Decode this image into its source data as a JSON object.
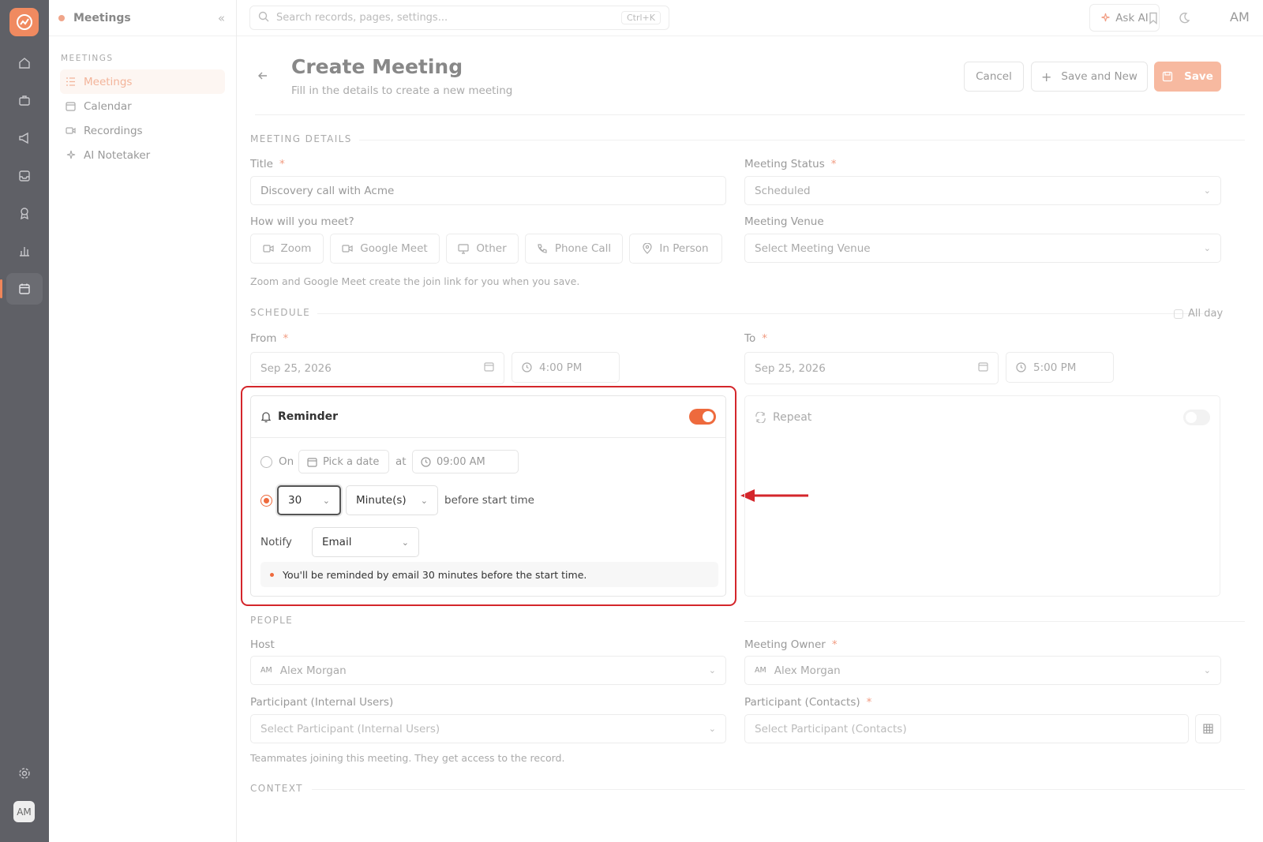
{
  "sidebar": {
    "title": "Meetings",
    "section": "MEETINGS",
    "items": [
      {
        "label": "Meetings",
        "icon": "list-icon"
      },
      {
        "label": "Calendar",
        "icon": "calendar-icon"
      },
      {
        "label": "Recordings",
        "icon": "video-icon"
      },
      {
        "label": "AI Notetaker",
        "icon": "sparkle-icon"
      }
    ]
  },
  "rail": {
    "avatar": "AM"
  },
  "topbar": {
    "search_placeholder": "Search records, pages, settings...",
    "shortcut": "Ctrl+K",
    "ask_ai": "Ask AI",
    "user_initials": "AM"
  },
  "header": {
    "title": "Create Meeting",
    "subtitle": "Fill in the details to create a new meeting",
    "cancel": "Cancel",
    "save_and_new": "Save and New",
    "save": "Save"
  },
  "details": {
    "section": "MEETING DETAILS",
    "title_label": "Title",
    "title_value": "Discovery call with Acme",
    "status_label": "Meeting Status",
    "status_value": "Scheduled",
    "how_label": "How will you meet?",
    "options": [
      "Zoom",
      "Google Meet",
      "Other",
      "Phone Call",
      "In Person"
    ],
    "venue_label": "Meeting Venue",
    "venue_placeholder": "Select Meeting Venue",
    "hint": "Zoom and Google Meet create the join link for you when you save."
  },
  "schedule": {
    "section": "SCHEDULE",
    "all_day": "All day",
    "from_label": "From",
    "from_date": "Sep 25, 2026",
    "from_time": "4:00 PM",
    "to_label": "To",
    "to_date": "Sep 25, 2026",
    "to_time": "5:00 PM"
  },
  "reminder": {
    "title": "Reminder",
    "enabled": true,
    "on_label": "On",
    "pick_date": "Pick a date",
    "at_label": "at",
    "at_time": "09:00 AM",
    "amount": "30",
    "unit": "Minute(s)",
    "before_text": "before start time",
    "notify_label": "Notify",
    "notify_value": "Email",
    "note": "You'll be reminded by email 30 minutes before the start time."
  },
  "repeat": {
    "title": "Repeat",
    "enabled": false
  },
  "people": {
    "section": "PEOPLE",
    "host_label": "Host",
    "host_initials": "AM",
    "host_value": "Alex Morgan",
    "owner_label": "Meeting Owner",
    "owner_initials": "AM",
    "owner_value": "Alex Morgan",
    "internal_label": "Participant (Internal Users)",
    "internal_placeholder": "Select Participant (Internal Users)",
    "contacts_label": "Participant (Contacts)",
    "contacts_placeholder": "Select Participant (Contacts)",
    "hint": "Teammates joining this meeting. They get access to the record."
  },
  "context": {
    "section": "CONTEXT"
  },
  "colors": {
    "accent": "#ee6a3d",
    "highlight": "#d4262b",
    "rail": "#5f6066"
  }
}
